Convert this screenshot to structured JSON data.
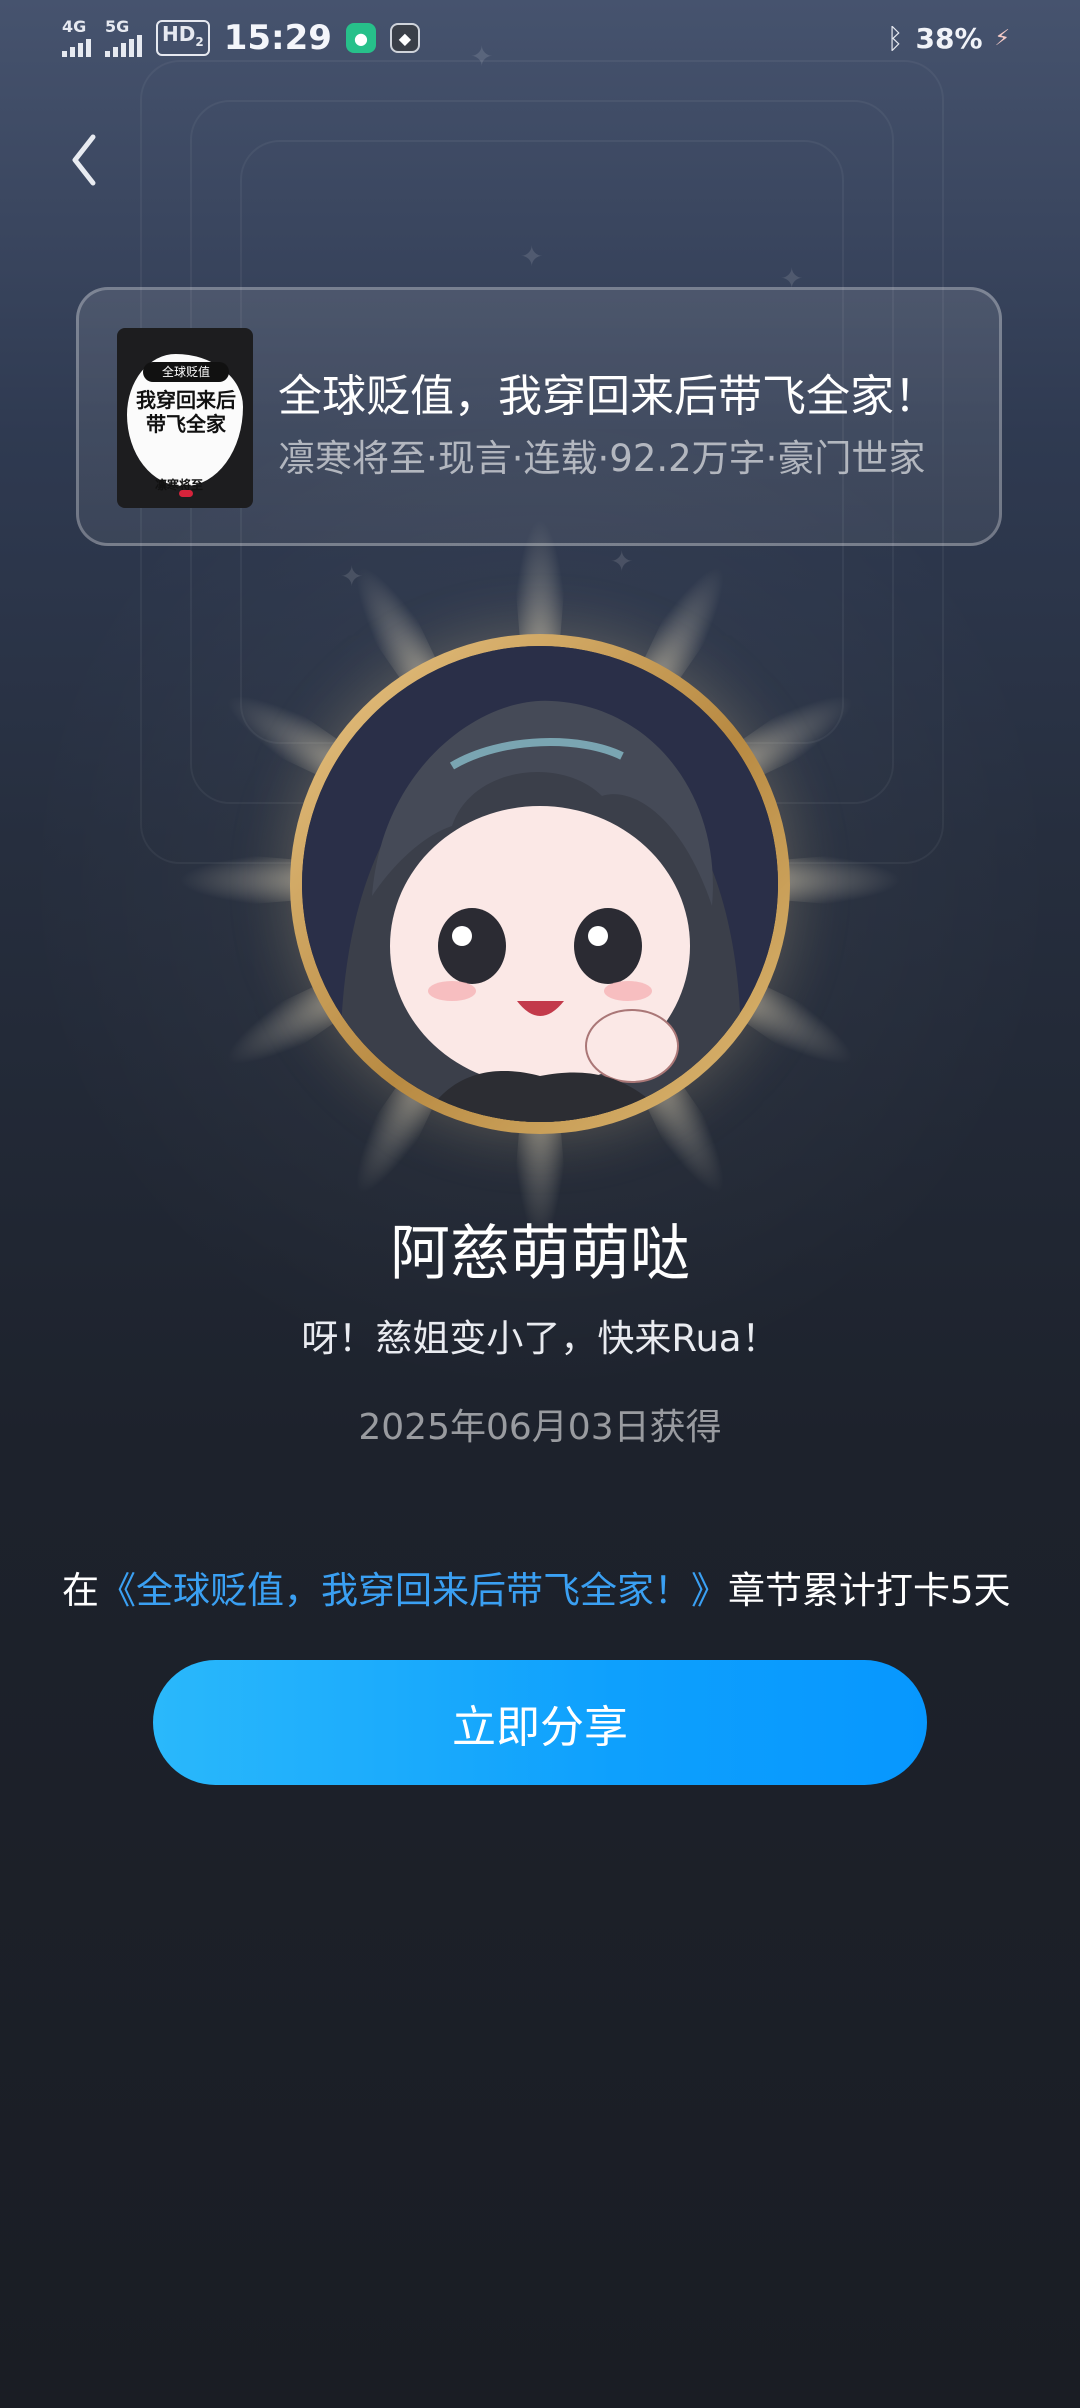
{
  "status_bar": {
    "net1": "4G",
    "net2": "5G",
    "hd": "HD",
    "hd_sub": "2",
    "time": "15:29",
    "battery": "38%"
  },
  "book": {
    "title": "全球贬值，我穿回来后带飞全家！",
    "meta": "凛寒将至·现言·连载·92.2万字·豪门世家",
    "cover_tag": "全球贬值",
    "cover_title": "我穿回来后带飞全家",
    "cover_author": "凛寒将至"
  },
  "badge": {
    "name": "阿慈萌萌哒",
    "description": "呀！慈姐变小了，快来Rua！",
    "date": "2025年06月03日获得"
  },
  "checkin": {
    "prefix": "在",
    "book_link": "《全球贬值，我穿回来后带飞全家！》",
    "suffix": "章节累计打卡5天"
  },
  "share_button": {
    "label": "立即分享"
  },
  "colors": {
    "accent": "#0ea0fd",
    "link": "#3aa0f3",
    "gold_ring": "#c99a52"
  },
  "icons": [
    "back-chevron-icon",
    "bluetooth-icon",
    "charging-icon",
    "signal-icon"
  ]
}
